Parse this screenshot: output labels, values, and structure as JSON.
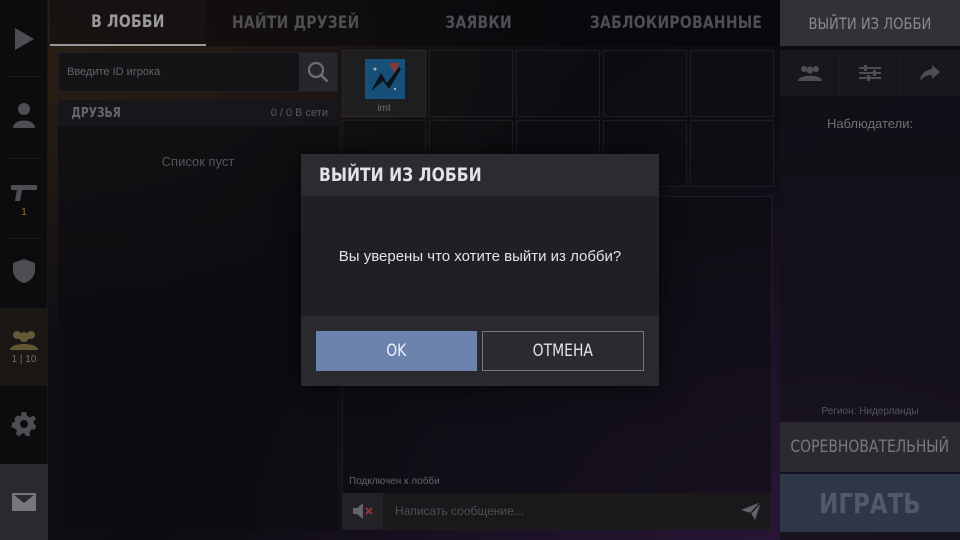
{
  "tabs": [
    {
      "label": "В ЛОББИ",
      "active": true
    },
    {
      "label": "НАЙТИ ДРУЗЕЙ",
      "active": false
    },
    {
      "label": "ЗАЯВКИ",
      "active": false
    },
    {
      "label": "ЗАБЛОКИРОВАННЫЕ",
      "active": false
    }
  ],
  "exit_tab": {
    "label": "ВЫЙТИ ИЗ ЛОББИ"
  },
  "sidebar": {
    "weapon_count": "1",
    "lobby_count": "1 | 10"
  },
  "search": {
    "placeholder": "Введите ID игрока"
  },
  "friends": {
    "title": "ДРУЗЬЯ",
    "online": "0 / 0 В сети",
    "empty": "Список пуст"
  },
  "player": {
    "name": "imt"
  },
  "chat": {
    "status": "Подключен к лобби",
    "placeholder": "Написать сообщение..."
  },
  "right_panel": {
    "observers": "Наблюдатели:",
    "region": "Регион: Нидерланды",
    "mode": "СОРЕВНОВАТЕЛЬНЫЙ",
    "play": "ИГРАТЬ"
  },
  "modal": {
    "title": "ВЫЙТИ ИЗ ЛОББИ",
    "message": "Вы уверены что хотите выйти из лобби?",
    "ok": "OK",
    "cancel": "ОТМЕНА"
  },
  "colors": {
    "accent_blue": "#6c84ad",
    "weapon_count": "#c9a441",
    "play_button": "#3f4d64"
  }
}
